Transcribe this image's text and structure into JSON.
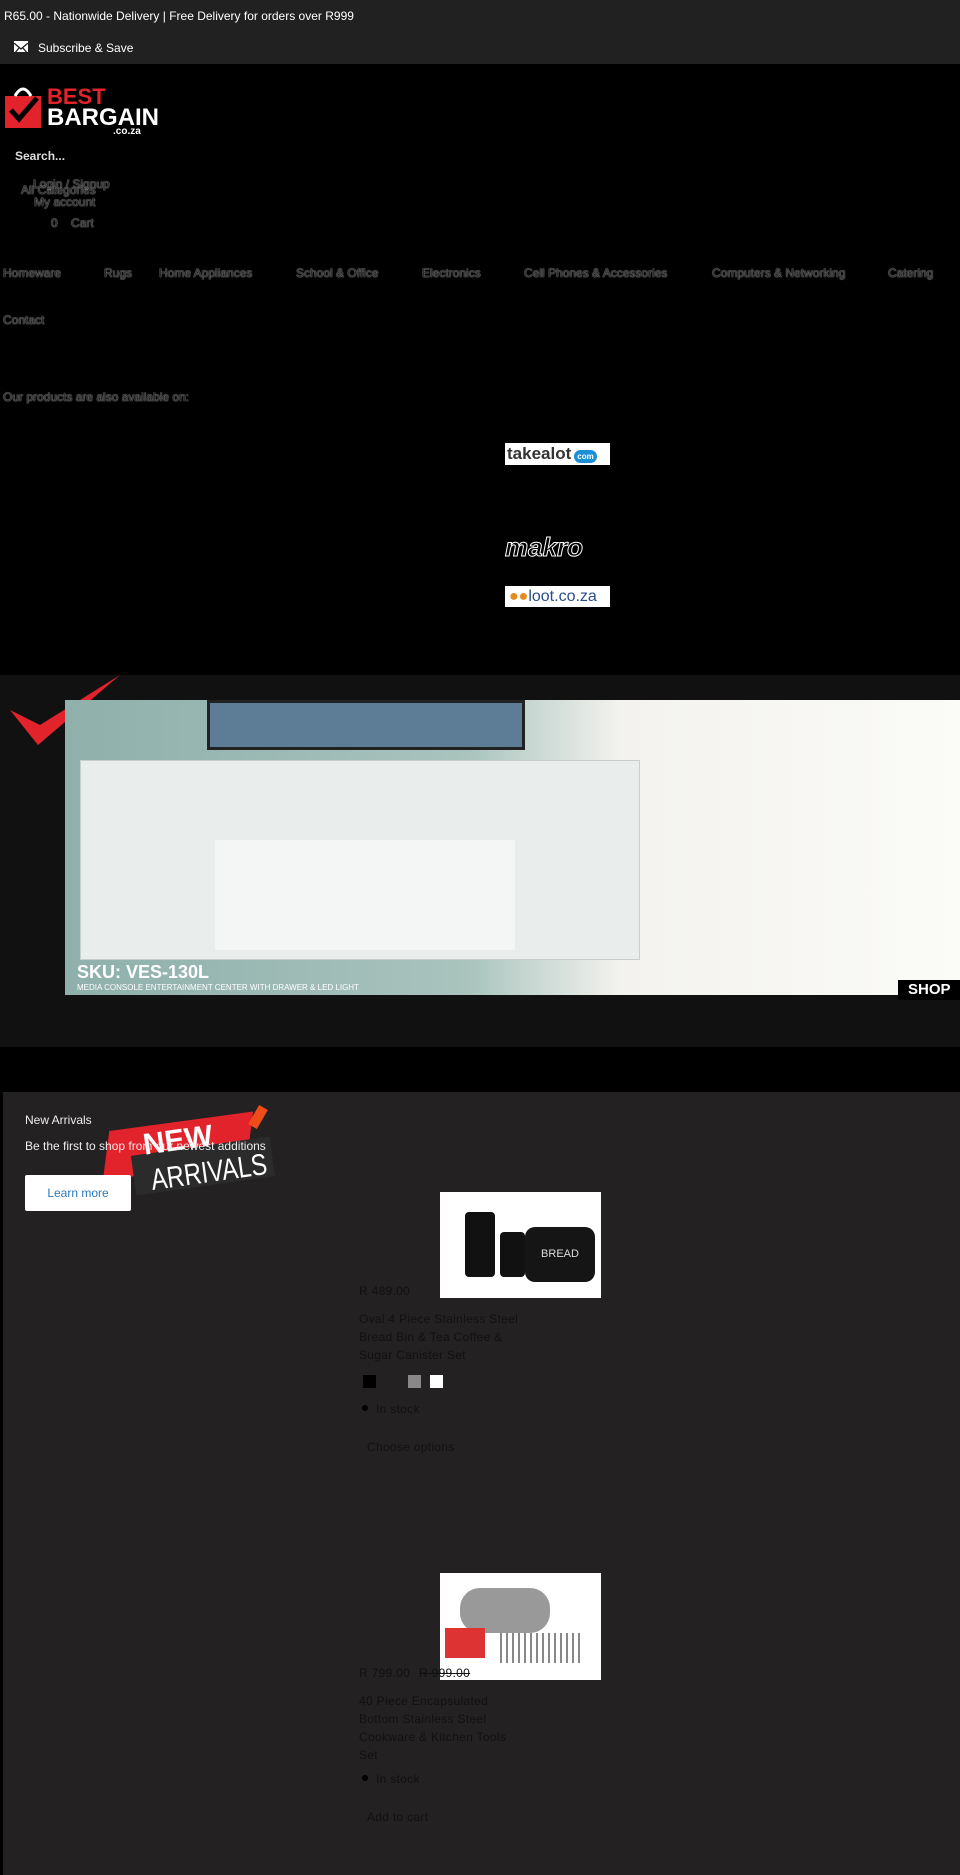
{
  "announcement": {
    "text": "R65.00 - Nationwide Delivery | Free Delivery for orders over R999",
    "subscribe": "Subscribe & Save",
    "icon": "mail-icon"
  },
  "header": {
    "logo": {
      "line1": "BEST",
      "line2": "BARGAIN",
      "line3": ".co.za"
    },
    "search_placeholder": "Search...",
    "login": "Login / Signup",
    "all_categories": "All Categories",
    "my_account": "My account",
    "cart_count": "0",
    "cart": "Cart"
  },
  "nav": {
    "items": [
      "Homeware",
      "Rugs",
      "Home Appliances",
      "School & Office",
      "Electronics",
      "Cell Phones & Accessories",
      "Computers & Networking",
      "Catering",
      "Contact"
    ]
  },
  "partners": {
    "label": "Our products are also available on:",
    "logos": [
      "takealot.com",
      "makro",
      "loot.co.za"
    ]
  },
  "banner": {
    "sku": "SKU: VES-130L",
    "subtitle": "MEDIA CONSOLE ENTERTAINMENT CENTER WITH DRAWER & LED LIGHT",
    "cta": "SHOP"
  },
  "new_arrivals": {
    "title": "New Arrivals",
    "subtitle": "Be the first to shop from our newest additions",
    "button": "Learn more",
    "badge_line1": "NEW",
    "badge_line2": "ARRIVALS"
  },
  "products": [
    {
      "price": "R 489.00",
      "name": "Oval 4 Piece Stainless Steel Bread Bin & Tea Coffee & Sugar Canister Set",
      "swatches": [
        "#000000",
        "#232122",
        "#888888",
        "#ffffff"
      ],
      "stock": "In stock",
      "action": "Choose options",
      "image_text": "BREAD"
    },
    {
      "price": "R 799.00",
      "compare_price": "R 999.00",
      "name": "40 Piece Encapsulated Bottom Stainless Steel Cookware & Kitchen Tools Set",
      "stock": "In stock",
      "action": "Add to cart"
    }
  ],
  "colors": {
    "brand_red": "#e3232b",
    "section_bg": "#232122",
    "link_blue": "#2a7ab8"
  }
}
